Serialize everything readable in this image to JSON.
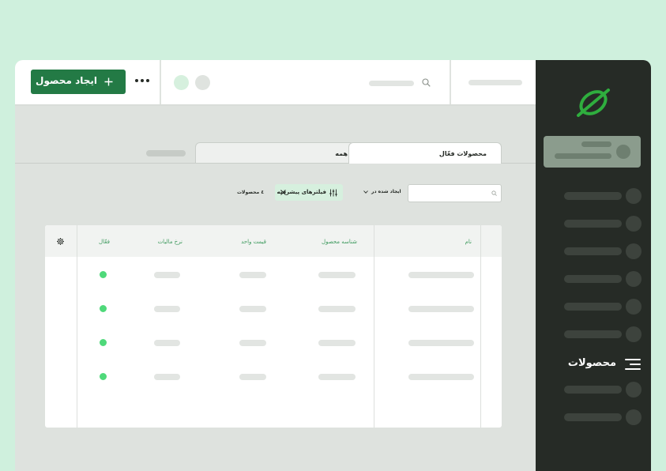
{
  "topbar": {
    "create_button_label": "ایجاد محصول",
    "more_icon": "more-horizontal-icon",
    "search_icon": "search-icon"
  },
  "sidebar": {
    "logo_icon": "leaf-logo-icon",
    "active_item_label": "محصولات",
    "active_item_icon": "menu-icon"
  },
  "tabs": {
    "active_label": "محصولات فعّال",
    "all_label": "همه"
  },
  "filters": {
    "created_in_label": "ایجاد شده در",
    "advanced_filters_label": "فیلترهای پیشرفته",
    "product_count": "٤ محصولات"
  },
  "table": {
    "columns": [
      "نام",
      "شناسه محصول",
      "قیمت واحد",
      "نرخ مالیات",
      "فعّال"
    ],
    "rows": [
      {
        "active": true
      },
      {
        "active": true
      },
      {
        "active": true
      },
      {
        "active": true
      }
    ]
  },
  "colors": {
    "background": "#cff0dd",
    "sidebar": "#262b26",
    "accent": "#237a45",
    "status_active": "#4fd97a",
    "column_header_text": "#3e9a5e"
  }
}
